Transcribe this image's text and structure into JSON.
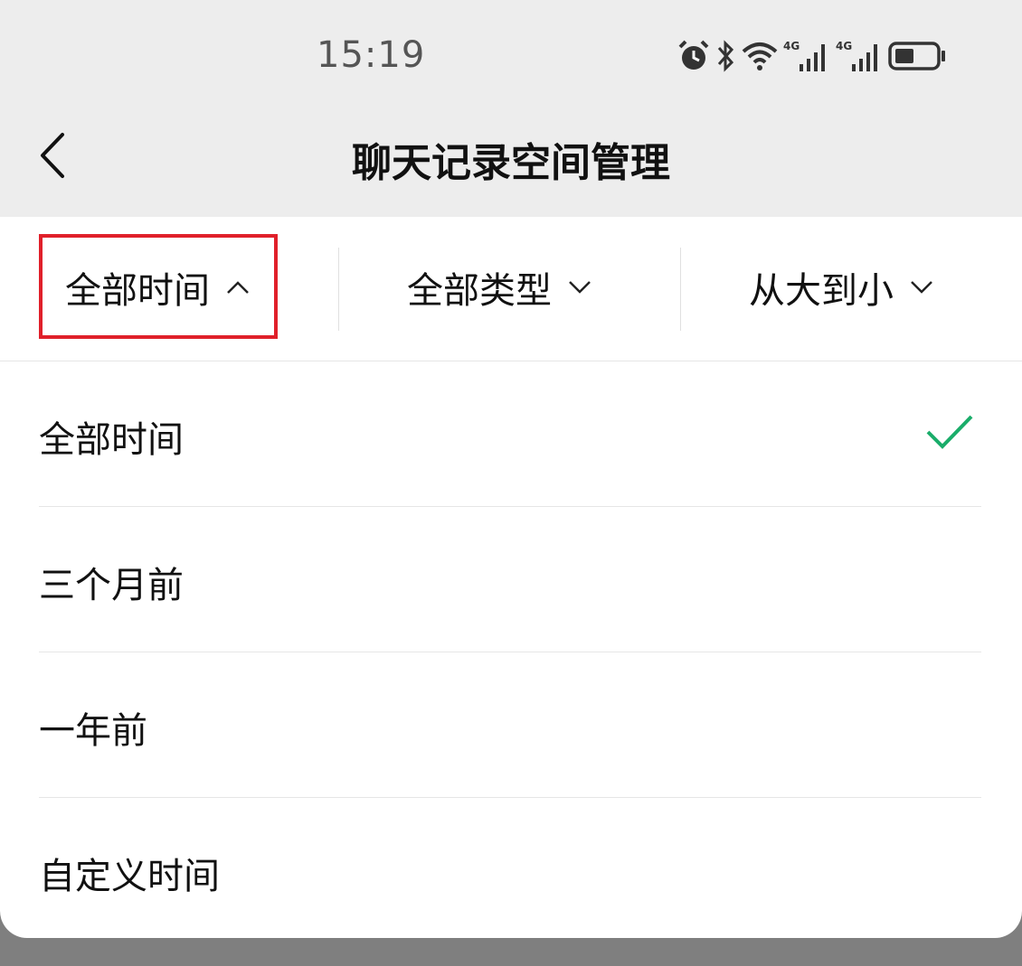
{
  "status_bar": {
    "time": "15:19",
    "icons": [
      "alarm-icon",
      "bluetooth-icon",
      "wifi-icon",
      "4g-signal-icon",
      "4g-signal-icon",
      "battery-icon"
    ],
    "network_label": "4G"
  },
  "nav": {
    "title": "聊天记录空间管理",
    "back_icon": "chevron-left-icon"
  },
  "filters": [
    {
      "label": "全部时间",
      "icon": "chevron-up-icon",
      "expanded": true
    },
    {
      "label": "全部类型",
      "icon": "chevron-down-icon",
      "expanded": false
    },
    {
      "label": "从大到小",
      "icon": "chevron-down-icon",
      "expanded": false
    }
  ],
  "options": [
    {
      "label": "全部时间",
      "selected": true
    },
    {
      "label": "三个月前",
      "selected": false
    },
    {
      "label": "一年前",
      "selected": false
    },
    {
      "label": "自定义时间",
      "selected": false
    }
  ],
  "colors": {
    "header_bg": "#ededed",
    "highlight": "#e0202a",
    "check": "#1aad6a",
    "overlay": "#7f7f7f"
  }
}
